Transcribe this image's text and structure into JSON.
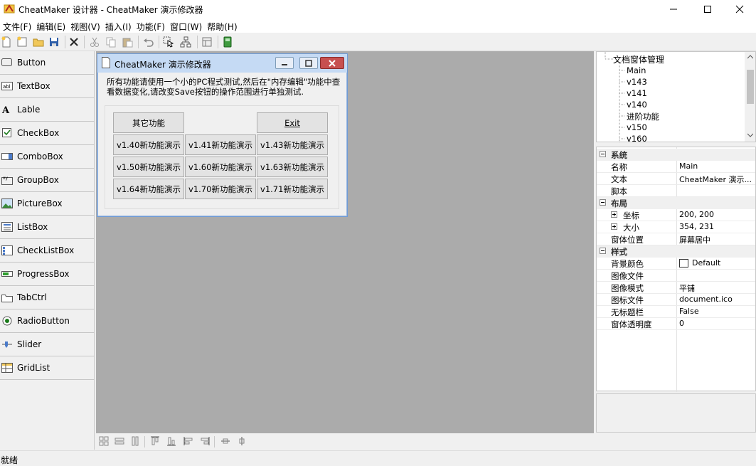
{
  "window": {
    "title": "CheatMaker 设计器 - CheatMaker 演示修改器"
  },
  "menu": [
    "文件(F)",
    "编辑(E)",
    "视图(V)",
    "插入(I)",
    "功能(F)",
    "窗口(W)",
    "帮助(H)"
  ],
  "toolbox": [
    {
      "label": "Button",
      "icon": "button-icon"
    },
    {
      "label": "TextBox",
      "icon": "textbox-icon"
    },
    {
      "label": "Lable",
      "icon": "label-icon"
    },
    {
      "label": "CheckBox",
      "icon": "checkbox-icon"
    },
    {
      "label": "ComboBox",
      "icon": "combobox-icon"
    },
    {
      "label": "GroupBox",
      "icon": "groupbox-icon"
    },
    {
      "label": "PictureBox",
      "icon": "picturebox-icon"
    },
    {
      "label": "ListBox",
      "icon": "listbox-icon"
    },
    {
      "label": "CheckListBox",
      "icon": "checklistbox-icon"
    },
    {
      "label": "ProgressBox",
      "icon": "progressbox-icon"
    },
    {
      "label": "TabCtrl",
      "icon": "tabctrl-icon"
    },
    {
      "label": "RadioButton",
      "icon": "radiobutton-icon"
    },
    {
      "label": "Slider",
      "icon": "slider-icon"
    },
    {
      "label": "GridList",
      "icon": "gridlist-icon"
    }
  ],
  "form": {
    "title": "CheatMaker 演示修改器",
    "description": "所有功能请使用一个小的PC程式测试,然后在\"内存编辑\"功能中查看数据变化,请改变Save按钮的操作范围进行单独测试.",
    "buttons": {
      "other": "其它功能",
      "exit": "Exit",
      "row1": [
        "v1.40新功能演示",
        "v1.41新功能演示",
        "v1.43新功能演示"
      ],
      "row2": [
        "v1.50新功能演示",
        "v1.60新功能演示",
        "v1.63新功能演示"
      ],
      "row3": [
        "v1.64新功能演示",
        "v1.70新功能演示",
        "v1.71新功能演示"
      ]
    }
  },
  "tree": {
    "root": "文档窗体管理",
    "children": [
      "Main",
      "v143",
      "v141",
      "v140",
      "进阶功能",
      "v150",
      "v160"
    ]
  },
  "properties": {
    "groups": {
      "system": "系统",
      "layout": "布局",
      "style": "样式"
    },
    "rows": {
      "name": {
        "name": "名称",
        "value": "Main"
      },
      "text": {
        "name": "文本",
        "value": "CheatMaker 演示..."
      },
      "script": {
        "name": "脚本",
        "value": ""
      },
      "pos": {
        "name": "坐标",
        "value": "200, 200"
      },
      "size": {
        "name": "大小",
        "value": "354, 231"
      },
      "winpos": {
        "name": "窗体位置",
        "value": "屏幕居中"
      },
      "bgcolor": {
        "name": "背景颜色",
        "value": "Default"
      },
      "image": {
        "name": "图像文件",
        "value": ""
      },
      "imagemode": {
        "name": "图像模式",
        "value": "平铺"
      },
      "iconfile": {
        "name": "图标文件",
        "value": "document.ico"
      },
      "notitle": {
        "name": "无标题栏",
        "value": "False"
      },
      "opacity": {
        "name": "窗体透明度",
        "value": "0"
      }
    }
  },
  "status": "就绪",
  "colors": {
    "design_bg": "#ababab",
    "form_title": "#c5daf4",
    "close_red": "#c75050"
  }
}
